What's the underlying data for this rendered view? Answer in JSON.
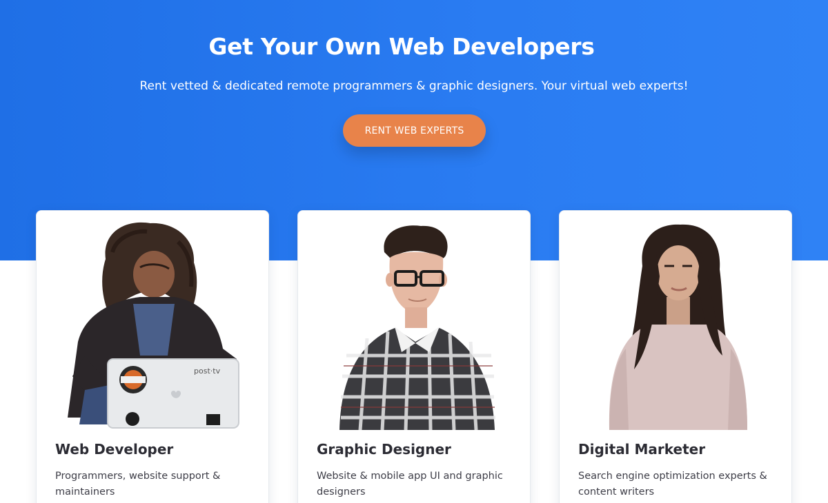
{
  "hero": {
    "title": "Get Your Own Web Developers",
    "subtitle": "Rent vetted & dedicated remote programmers & graphic designers. Your virtual web experts!",
    "cta_label": "RENT WEB EXPERTS"
  },
  "cards": [
    {
      "title": "Web Developer",
      "description": "Programmers, website support & maintainers",
      "photo_alt": "woman-with-laptop-photo",
      "laptop_sticker": "post tv"
    },
    {
      "title": "Graphic Designer",
      "description": "Website & mobile app UI and graphic designers",
      "photo_alt": "man-with-glasses-photo"
    },
    {
      "title": "Digital Marketer",
      "description": "Search engine optimization experts & content writers",
      "photo_alt": "woman-in-sweater-photo"
    }
  ],
  "colors": {
    "hero_blue": "#2a7cf2",
    "cta_orange": "#e8834a",
    "title_text": "#2b2b33"
  }
}
